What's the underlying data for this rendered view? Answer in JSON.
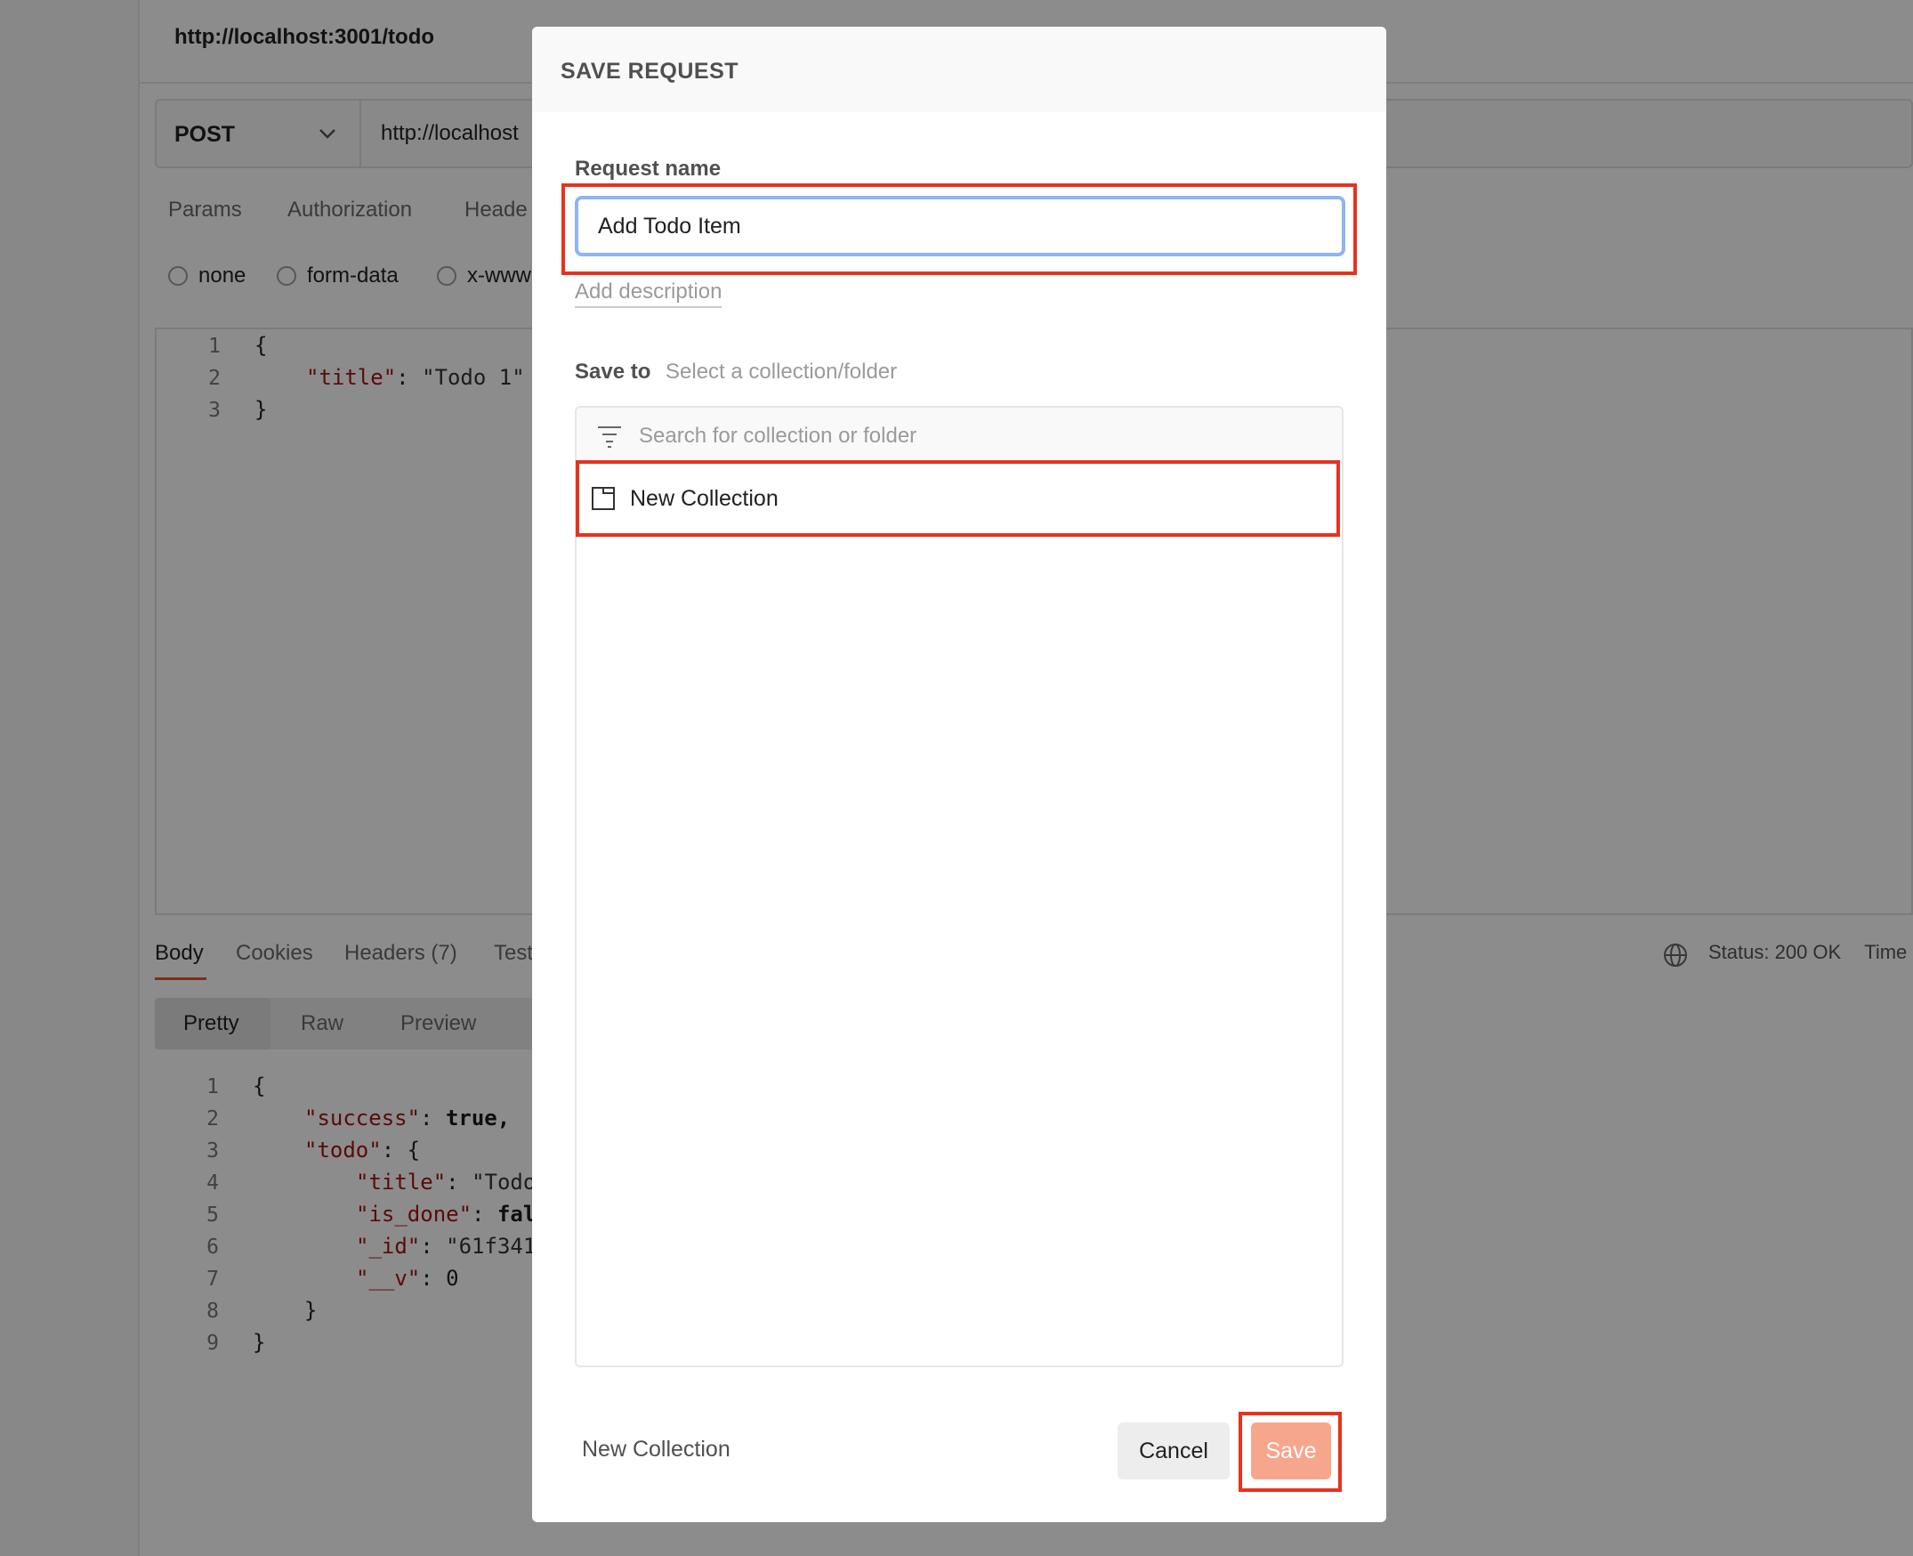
{
  "background": {
    "request_title": "http://localhost:3001/todo",
    "method": "POST",
    "url": "http://localhost",
    "request_tabs": [
      "Params",
      "Authorization",
      "Heade"
    ],
    "body_modes": [
      "none",
      "form-data",
      "x-www"
    ],
    "request_body_lines": [
      {
        "n": "1",
        "text": "{"
      },
      {
        "n": "2",
        "key": "\"title\"",
        "sep": ": ",
        "value": "\"Todo 1\""
      },
      {
        "n": "3",
        "text": "}"
      }
    ],
    "response_tabs": [
      "Body",
      "Cookies",
      "Headers (7)",
      "Test"
    ],
    "status_text": "Status: 200 OK",
    "time_text": "Time",
    "view_modes": [
      "Pretty",
      "Raw",
      "Preview"
    ],
    "response_body_lines": [
      {
        "n": "1",
        "text": "{"
      },
      {
        "n": "2",
        "key": "\"success\"",
        "sep": ": ",
        "value": "true,"
      },
      {
        "n": "3",
        "key": "\"todo\"",
        "sep": ": ",
        "value": "{"
      },
      {
        "n": "4",
        "key": "\"title\"",
        "sep": ": ",
        "value": "\"Todo"
      },
      {
        "n": "5",
        "key": "\"is_done\"",
        "sep": ": ",
        "value": "fal"
      },
      {
        "n": "6",
        "key": "\"_id\"",
        "sep": ": ",
        "value": "\"61f341"
      },
      {
        "n": "7",
        "key": "\"__v\"",
        "sep": ": ",
        "value": "0"
      },
      {
        "n": "8",
        "text": "}"
      },
      {
        "n": "9",
        "text": "}"
      }
    ]
  },
  "modal": {
    "title": "SAVE REQUEST",
    "request_name_label": "Request name",
    "request_name_value": "Add Todo Item",
    "add_description": "Add description",
    "save_to_label": "Save to",
    "save_to_hint": "Select a collection/folder",
    "search_placeholder": "Search for collection or folder",
    "collections": [
      {
        "label": "New Collection",
        "icon": "collection-icon"
      }
    ],
    "footer_new_collection": "New Collection",
    "cancel_label": "Cancel",
    "save_label": "Save"
  },
  "colors": {
    "accent": "#f7a68e",
    "annotation": "#e8321d",
    "input_focus": "#8fb4ef"
  }
}
